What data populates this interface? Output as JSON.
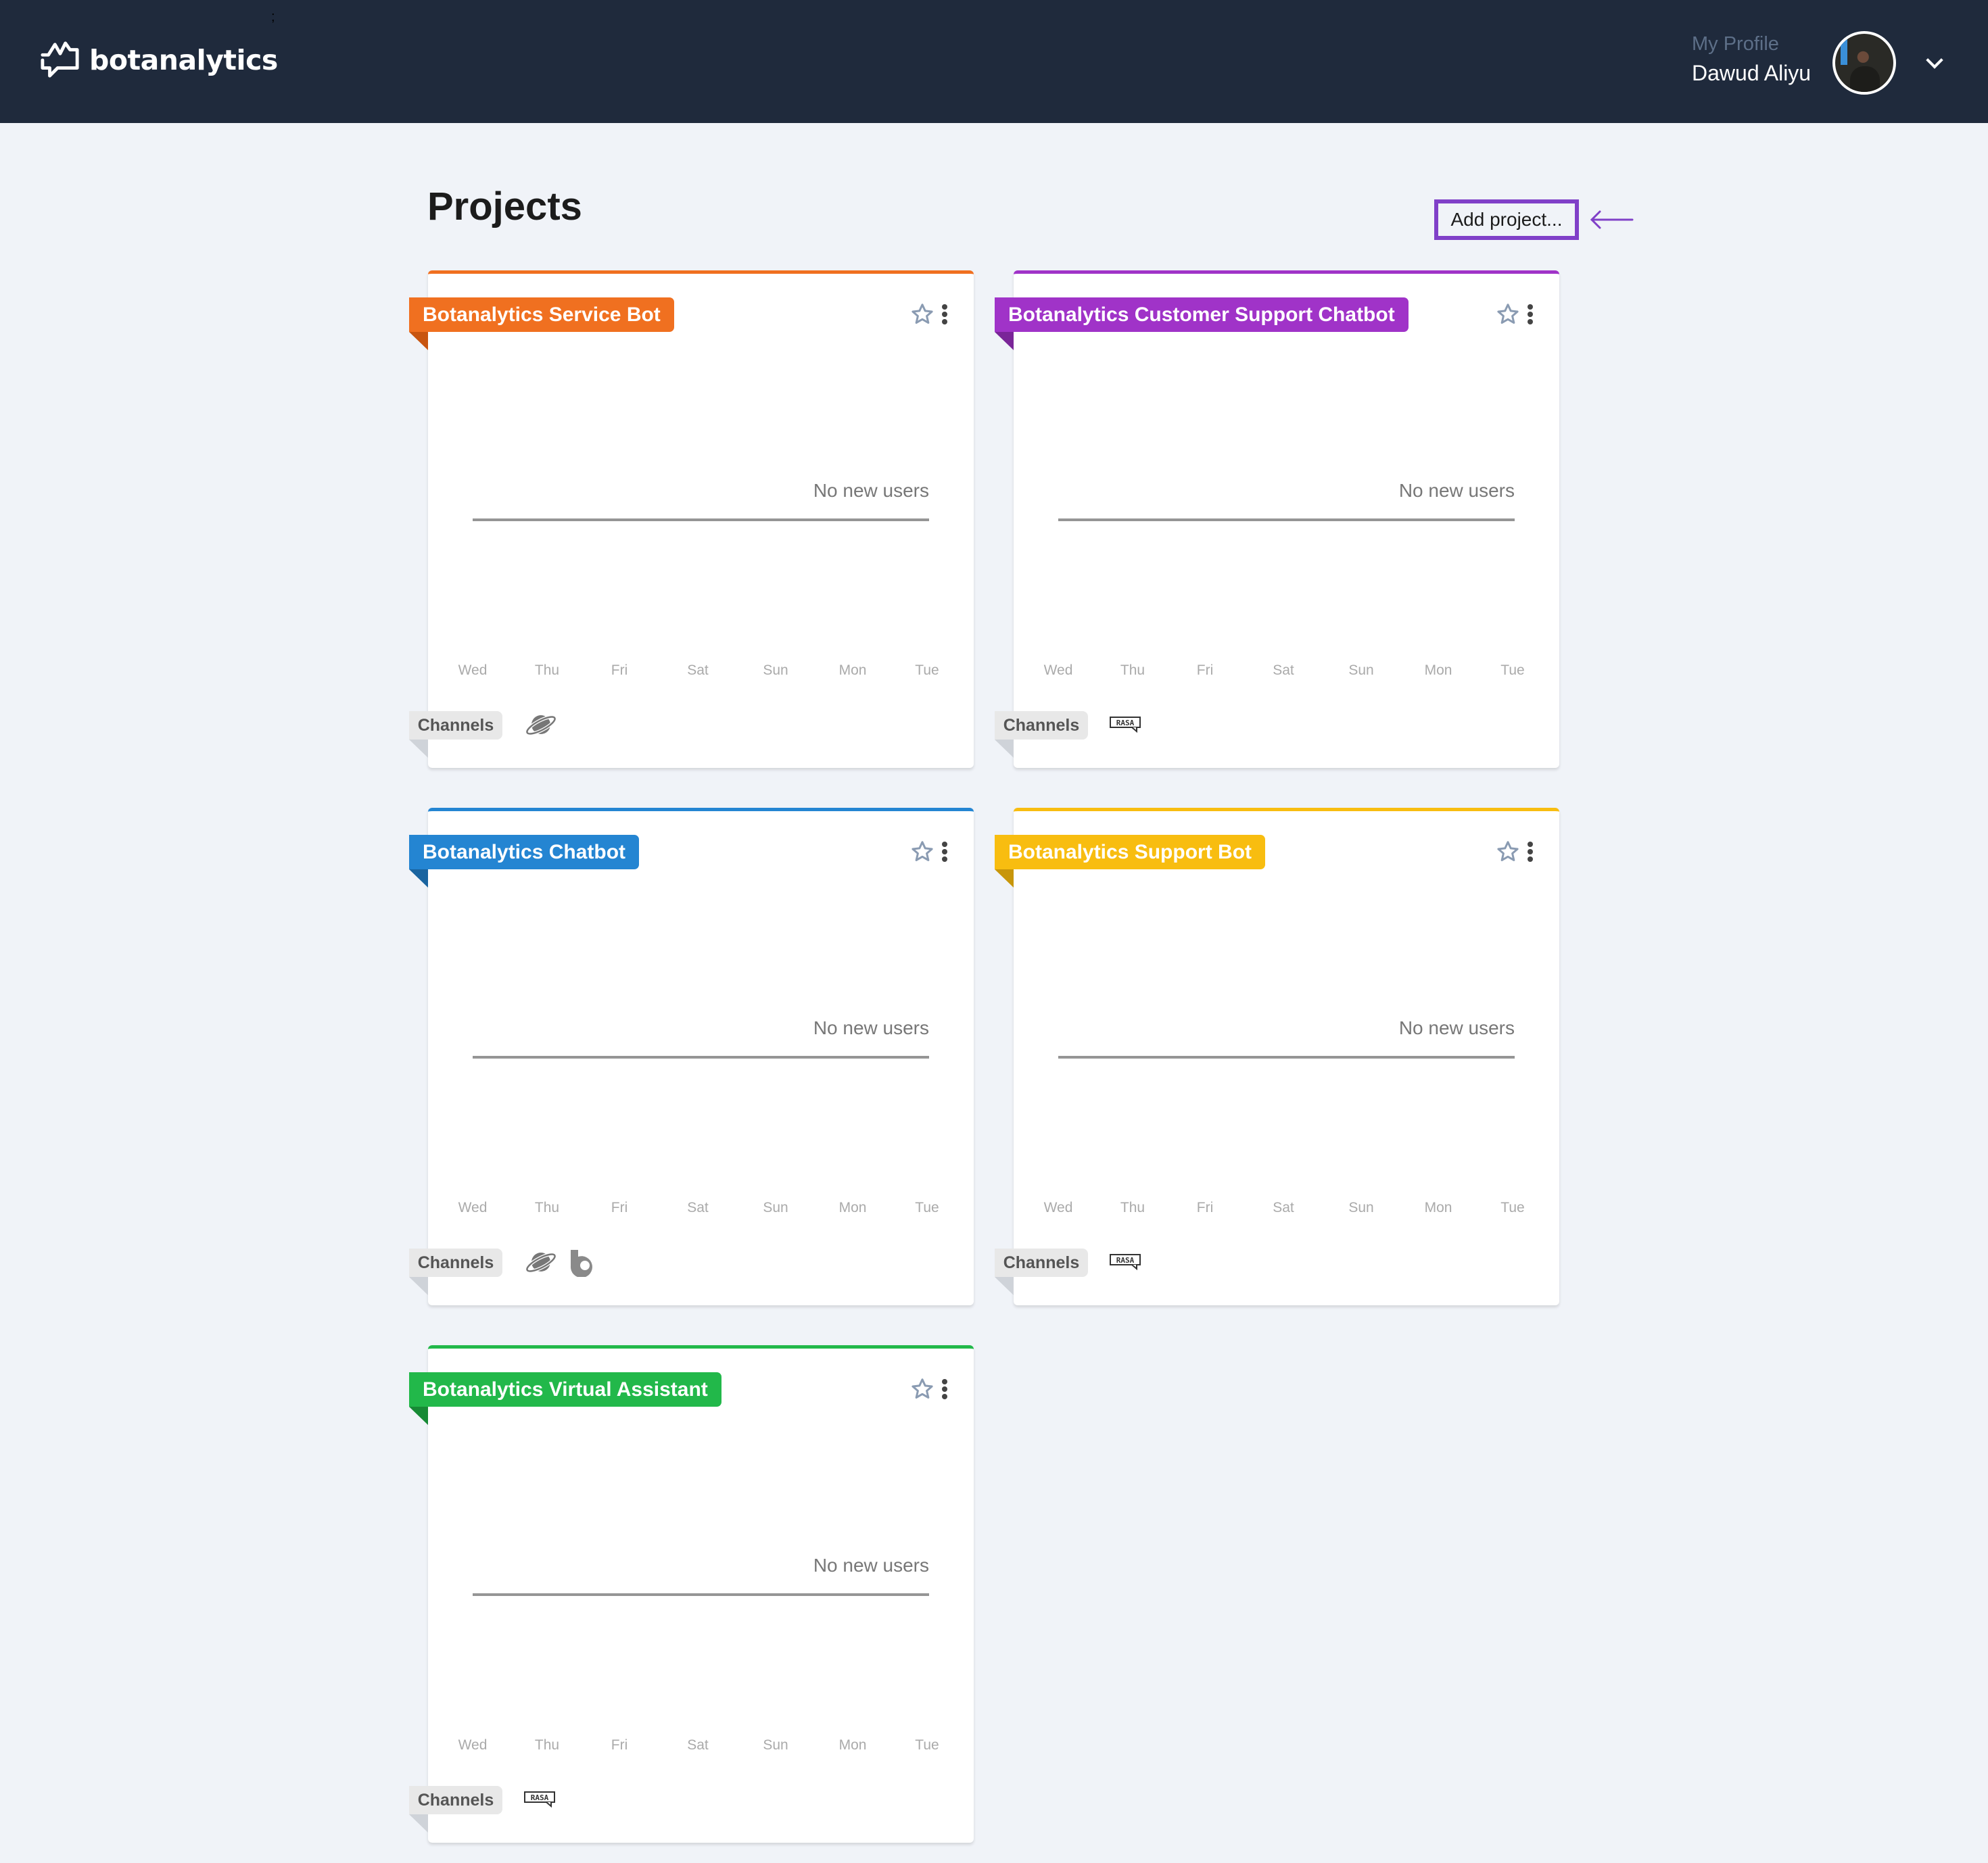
{
  "header": {
    "brand": "botanalytics",
    "stray_mark": ";",
    "profile_label": "My Profile",
    "profile_name": "Dawud Aliyu",
    "icons": {
      "logo": "chat-chart-logo-icon",
      "avatar": "user-avatar",
      "menu": "chevron-down-icon"
    }
  },
  "page": {
    "title": "Projects",
    "add_project_label": "Add project...",
    "annotation_color": "#8040c8"
  },
  "chart_labels": {
    "empty_message": "No new users",
    "days": [
      "Wed",
      "Thu",
      "Fri",
      "Sat",
      "Sun",
      "Mon",
      "Tue"
    ]
  },
  "projects": [
    {
      "name": "Botanalytics Service Bot",
      "color": "#f07020",
      "fold_color": "#c85510",
      "channels_label": "Channels",
      "channels": [
        "planet-icon"
      ],
      "favorite": false,
      "message": "No new users"
    },
    {
      "name": "Botanalytics Customer Support Chatbot",
      "color": "#a033c8",
      "fold_color": "#7a2598",
      "channels_label": "Channels",
      "channels": [
        "rasa-icon"
      ],
      "favorite": false,
      "message": "No new users"
    },
    {
      "name": "Botanalytics Chatbot",
      "color": "#2485d2",
      "fold_color": "#1a64a0",
      "channels_label": "Channels",
      "channels": [
        "planet-icon",
        "bixby-icon"
      ],
      "favorite": false,
      "message": "No new users"
    },
    {
      "name": "Botanalytics Support Bot",
      "color": "#f8bd10",
      "fold_color": "#c8960a",
      "channels_label": "Channels",
      "channels": [
        "rasa-icon"
      ],
      "favorite": false,
      "message": "No new users"
    },
    {
      "name": "Botanalytics Virtual Assistant",
      "color": "#22b84a",
      "fold_color": "#178a35",
      "channels_label": "Channels",
      "channels": [
        "rasa-icon"
      ],
      "favorite": false,
      "message": "No new users"
    }
  ],
  "chart_data": {
    "type": "line",
    "title": "",
    "categories": [
      "Wed",
      "Thu",
      "Fri",
      "Sat",
      "Sun",
      "Mon",
      "Tue"
    ],
    "series": [],
    "annotation": "No new users"
  }
}
